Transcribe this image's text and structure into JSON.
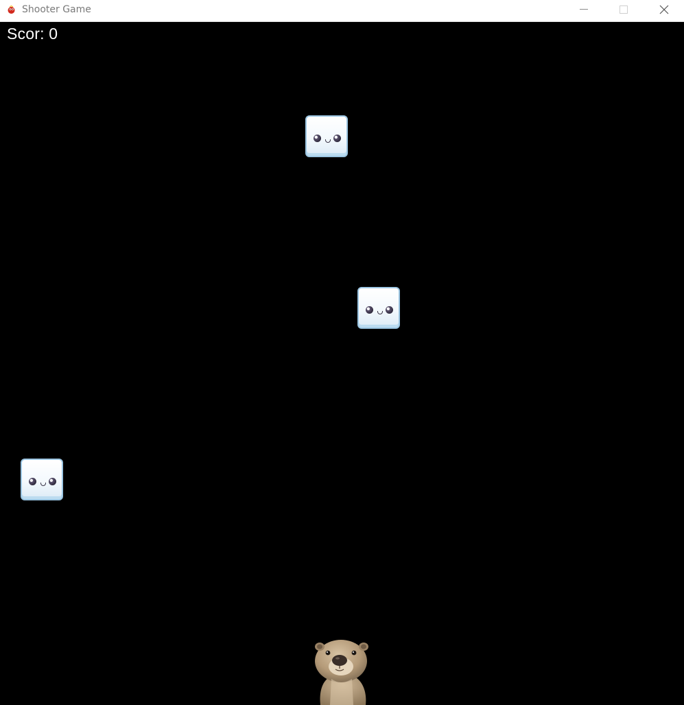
{
  "window": {
    "title": "Shooter Game",
    "icon": "pygame-snake-icon",
    "controls": [
      "minimize-icon",
      "maximize-icon",
      "close-icon"
    ]
  },
  "hud": {
    "score_label": "Scor:",
    "score_value": "0"
  },
  "colors": {
    "background": "#000000",
    "hud_text": "#ffffff",
    "enemy_fill": "#f4f9fd",
    "enemy_border": "#9cc6e3",
    "player_fur": "#b49a78"
  },
  "sprites": {
    "enemies": [
      "marshmallow-enemy",
      "marshmallow-enemy",
      "marshmallow-enemy"
    ],
    "player": "otter-player"
  }
}
